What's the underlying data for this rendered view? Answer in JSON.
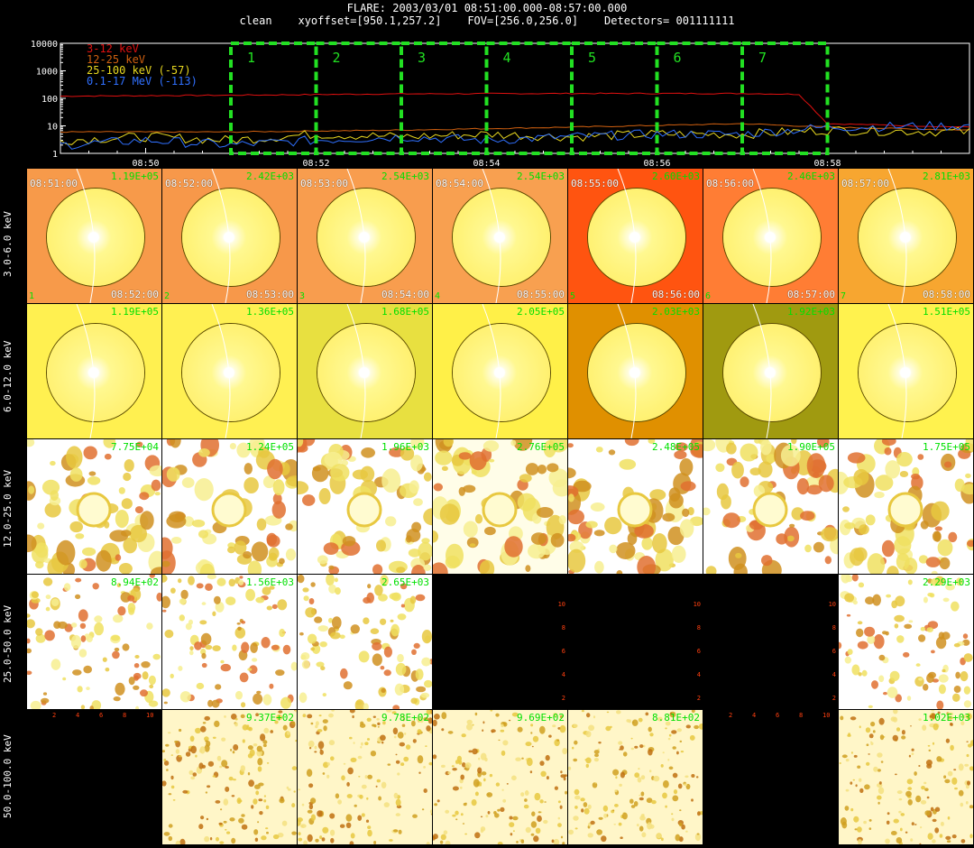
{
  "header": {
    "line1": "FLARE: 2003/03/01 08:51:00.000-08:57:00.000",
    "line2": "clean    xyoffset=[950.1,257.2]    FOV=[256.0,256.0]    Detectors= 001111111"
  },
  "chart_data": [
    {
      "type": "line",
      "yscale": "log",
      "ylim": [
        1,
        10000
      ],
      "y_ticks": [
        "10000",
        "1000",
        "100",
        "10",
        "1"
      ],
      "xlim": [
        "08:49:00",
        "08:59:40"
      ],
      "x_ticks": [
        "08:50",
        "08:52",
        "08:54",
        "08:56",
        "08:58"
      ],
      "legend_position": "top-left",
      "series": [
        {
          "name": "3-12 keV",
          "color": "#e01010",
          "x": [
            "08:49:00",
            "08:51:00",
            "08:53:00",
            "08:55:00",
            "08:57:00",
            "08:57:40",
            "08:58:00",
            "08:59:40"
          ],
          "y": [
            120,
            130,
            145,
            150,
            150,
            140,
            12,
            9
          ]
        },
        {
          "name": "12-25 keV",
          "color": "#d06010",
          "x": [
            "08:49:00",
            "08:51:00",
            "08:53:00",
            "08:55:00",
            "08:57:00",
            "08:58:00",
            "08:59:40"
          ],
          "y": [
            6,
            6,
            7,
            9,
            12,
            9,
            7
          ]
        },
        {
          "name": "25-100 keV (-57)",
          "color": "#e8d820",
          "x": [
            "08:49:00",
            "08:50:00",
            "08:51:00",
            "08:52:00",
            "08:53:00",
            "08:54:00",
            "08:55:00",
            "08:56:00",
            "08:57:00",
            "08:58:00",
            "08:59:40"
          ],
          "y": [
            3,
            4,
            3,
            5,
            4,
            5,
            4,
            5,
            5,
            7,
            6
          ]
        },
        {
          "name": "0.1-17 MeV (-113)",
          "color": "#3070ff",
          "x": [
            "08:49:00",
            "08:50:00",
            "08:51:00",
            "08:52:00",
            "08:53:00",
            "08:54:00",
            "08:55:00",
            "08:56:00",
            "08:57:00",
            "08:58:00",
            "08:59:40"
          ],
          "y": [
            2,
            3,
            2,
            3,
            4,
            3,
            4,
            5,
            5,
            9,
            10
          ]
        }
      ],
      "intervals": [
        {
          "label": "1",
          "start": "08:51:00",
          "end": "08:52:00"
        },
        {
          "label": "2",
          "start": "08:52:00",
          "end": "08:53:00"
        },
        {
          "label": "3",
          "start": "08:53:00",
          "end": "08:54:00"
        },
        {
          "label": "4",
          "start": "08:54:00",
          "end": "08:55:00"
        },
        {
          "label": "5",
          "start": "08:55:00",
          "end": "08:56:00"
        },
        {
          "label": "6",
          "start": "08:56:00",
          "end": "08:57:00"
        },
        {
          "label": "7",
          "start": "08:57:00",
          "end": "08:58:00"
        }
      ]
    },
    {
      "type": "heatmap",
      "energy_bands": [
        "3.0-6.0 keV",
        "6.0-12.0 keV",
        "12.0-25.0 keV",
        "25.0-50.0 keV",
        "50.0-100.0 keV"
      ],
      "time_starts": [
        "08:51:00",
        "08:52:00",
        "08:53:00",
        "08:54:00",
        "08:55:00",
        "08:56:00",
        "08:57:00"
      ],
      "time_ends": [
        "08:52:00",
        "08:53:00",
        "08:54:00",
        "08:55:00",
        "08:56:00",
        "08:57:00",
        "08:58:00"
      ],
      "max_counts": [
        [
          "1.19E+05",
          "2.42E+03",
          "2.54E+03",
          "2.54E+03",
          "2.60E+03",
          "2.46E+03",
          "2.81E+03"
        ],
        [
          "1.19E+05",
          "1.36E+05",
          "1.68E+05",
          "2.05E+05",
          "2.03E+03",
          "1.92E+03",
          "1.51E+05"
        ],
        [
          "7.75E+04",
          "1.24E+05",
          "1.96E+03",
          "2.76E+05",
          "2.48E+05",
          "1.90E+05",
          "1.75E+05"
        ],
        [
          "8.94E+02",
          "1.56E+03",
          "2.65E+03",
          "",
          "",
          "",
          "2.29E+03"
        ],
        [
          "",
          "9.37E+02",
          "9.78E+02",
          "9.69E+02",
          "8.81E+02",
          "",
          "1.02E+03"
        ]
      ],
      "background_colors": [
        [
          "#f79a4a",
          "#f7984a",
          "#f89d4e",
          "#f8a050",
          "#ff5410",
          "#ff7d34",
          "#f7a630"
        ],
        [
          "#fff050",
          "#fff052",
          "#e8e040",
          "#fff048",
          "#e09000",
          "#a09a10",
          "#fff24e"
        ],
        [
          "#ffffff",
          "#ffffff",
          "#ffffff",
          "#fffde8",
          "#ffffff",
          "#ffffff",
          "#ffffff"
        ],
        [
          "#ffffff",
          "#ffffff",
          "#ffffff",
          "#000000",
          "#000000",
          "#000000",
          "#ffffff"
        ],
        [
          "#000000",
          "#fff6c8",
          "#fff6c8",
          "#fff6c8",
          "#fff6c8",
          "#000000",
          "#fff6c8"
        ]
      ],
      "blank_frame_axis_ticks": [
        "2",
        "4",
        "6",
        "8",
        "10"
      ]
    }
  ]
}
